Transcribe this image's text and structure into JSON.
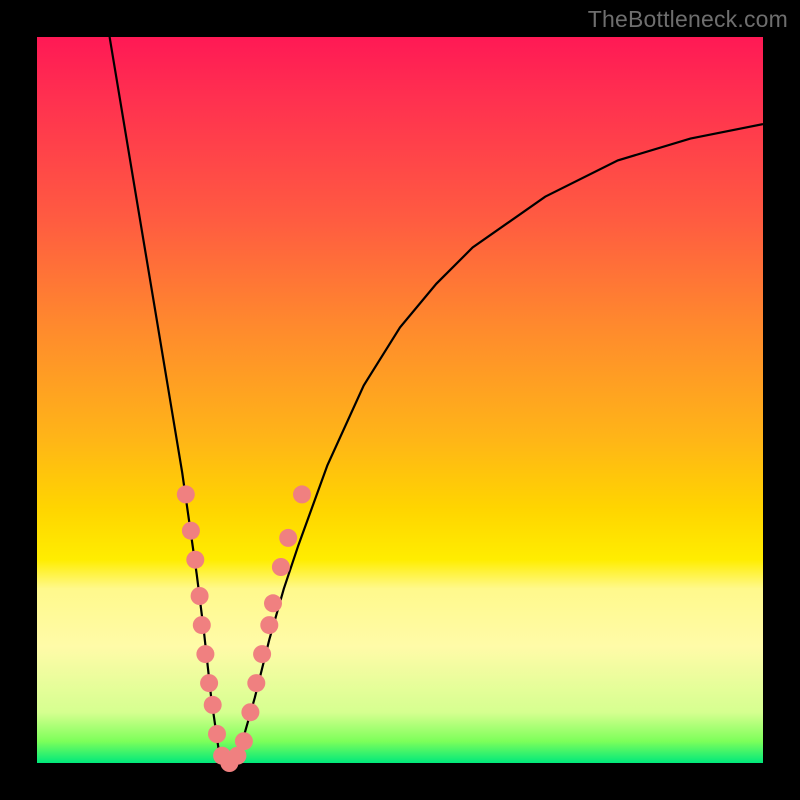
{
  "watermark": "TheBottleneck.com",
  "chart_data": {
    "type": "line",
    "title": "",
    "xlabel": "",
    "ylabel": "",
    "xlim": [
      0,
      100
    ],
    "ylim": [
      0,
      100
    ],
    "grid": false,
    "legend": false,
    "series": [
      {
        "name": "bottleneck-curve",
        "x": [
          10,
          12,
          14,
          16,
          18,
          20,
          22,
          23,
          24,
          25,
          26,
          27,
          28,
          30,
          32,
          34,
          36,
          40,
          45,
          50,
          55,
          60,
          70,
          80,
          90,
          100
        ],
        "values": [
          100,
          88,
          76,
          64,
          52,
          40,
          26,
          18,
          9,
          2,
          0,
          0,
          2,
          9,
          17,
          24,
          30,
          41,
          52,
          60,
          66,
          71,
          78,
          83,
          86,
          88
        ],
        "stroke": "#000000"
      }
    ],
    "scatter_overlay": {
      "name": "sample-points",
      "fill": "#f08080",
      "radius": 9,
      "points": [
        {
          "x": 20.5,
          "y": 37
        },
        {
          "x": 21.2,
          "y": 32
        },
        {
          "x": 21.8,
          "y": 28
        },
        {
          "x": 22.4,
          "y": 23
        },
        {
          "x": 22.7,
          "y": 19
        },
        {
          "x": 23.2,
          "y": 15
        },
        {
          "x": 23.7,
          "y": 11
        },
        {
          "x": 24.2,
          "y": 8
        },
        {
          "x": 24.8,
          "y": 4
        },
        {
          "x": 25.5,
          "y": 1
        },
        {
          "x": 26.5,
          "y": 0
        },
        {
          "x": 27.6,
          "y": 1
        },
        {
          "x": 28.5,
          "y": 3
        },
        {
          "x": 29.4,
          "y": 7
        },
        {
          "x": 30.2,
          "y": 11
        },
        {
          "x": 31.0,
          "y": 15
        },
        {
          "x": 32.0,
          "y": 19
        },
        {
          "x": 32.5,
          "y": 22
        },
        {
          "x": 33.6,
          "y": 27
        },
        {
          "x": 34.6,
          "y": 31
        },
        {
          "x": 36.5,
          "y": 37
        }
      ]
    }
  }
}
